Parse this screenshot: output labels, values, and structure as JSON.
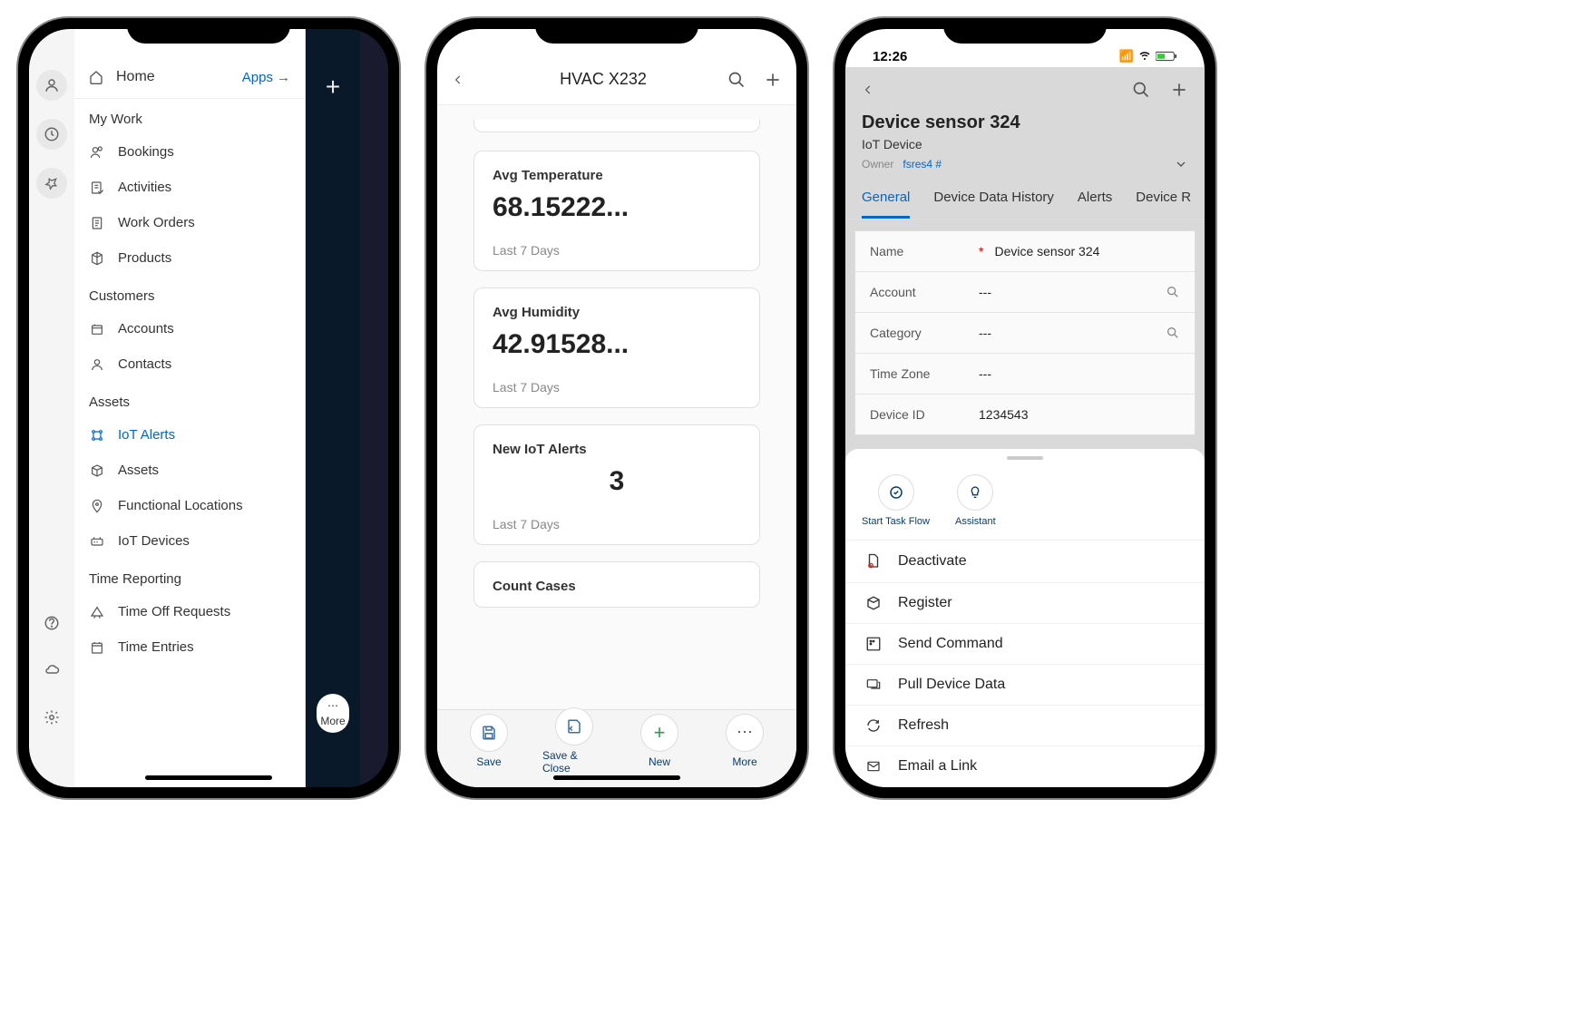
{
  "phone1": {
    "home": "Home",
    "apps": "Apps",
    "sections": {
      "my_work": "My Work",
      "customers": "Customers",
      "assets": "Assets",
      "time_reporting": "Time Reporting"
    },
    "items": {
      "bookings": "Bookings",
      "activities": "Activities",
      "work_orders": "Work Orders",
      "products": "Products",
      "accounts": "Accounts",
      "contacts": "Contacts",
      "iot_alerts": "IoT Alerts",
      "assets": "Assets",
      "functional_locations": "Functional Locations",
      "iot_devices": "IoT Devices",
      "time_off_requests": "Time Off Requests",
      "time_entries": "Time Entries"
    },
    "more": "More"
  },
  "phone2": {
    "title": "HVAC X232",
    "cards": [
      {
        "label": "Avg Temperature",
        "value": "68.15222...",
        "period": "Last 7 Days"
      },
      {
        "label": "Avg Humidity",
        "value": "42.91528...",
        "period": "Last 7 Days"
      },
      {
        "label": "New IoT Alerts",
        "value": "3",
        "period": "Last 7 Days"
      },
      {
        "label": "Count Cases",
        "value": "",
        "period": ""
      }
    ],
    "toolbar": {
      "save": "Save",
      "save_close": "Save & Close",
      "new": "New",
      "more": "More"
    }
  },
  "phone3": {
    "status_time": "12:26",
    "title": "Device sensor 324",
    "subtitle": "IoT Device",
    "owner_label": "Owner",
    "owner_value": "fsres4 #",
    "tabs": [
      "General",
      "Device Data History",
      "Alerts",
      "Device R"
    ],
    "form": {
      "name_label": "Name",
      "name_value": "Device sensor 324",
      "account_label": "Account",
      "account_value": "---",
      "category_label": "Category",
      "category_value": "---",
      "timezone_label": "Time Zone",
      "timezone_value": "---",
      "deviceid_label": "Device ID",
      "deviceid_value": "1234543"
    },
    "top_actions": {
      "start_task_flow": "Start Task Flow",
      "assistant": "Assistant"
    },
    "actions": {
      "deactivate": "Deactivate",
      "register": "Register",
      "send_command": "Send Command",
      "pull_device_data": "Pull Device Data",
      "refresh": "Refresh",
      "email_link": "Email a Link"
    }
  }
}
